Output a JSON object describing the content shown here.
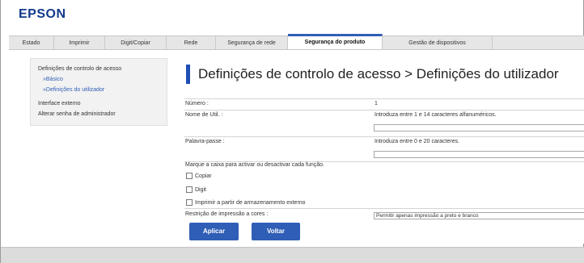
{
  "header": {
    "logo": "EPSON"
  },
  "tabs": [
    {
      "label": "Estado"
    },
    {
      "label": "Imprimir"
    },
    {
      "label": "Digit/Copiar"
    },
    {
      "label": "Rede"
    },
    {
      "label": "Segurança de rede"
    },
    {
      "label": "Segurança do produto"
    },
    {
      "label": "Gestão de dispositivos"
    }
  ],
  "sidebar": {
    "group_label": "Definições de controlo de acesso",
    "sub_items": [
      {
        "label": "»Básico"
      },
      {
        "label": "»Definições do utilizador"
      }
    ],
    "items": [
      {
        "label": "Interface externo"
      },
      {
        "label": "Alterar senha de administrador"
      }
    ]
  },
  "page": {
    "title": "Definições de controlo de acesso > Definições do utilizador"
  },
  "form": {
    "number": {
      "label": "Número :",
      "value": "1"
    },
    "username": {
      "label": "Nome de Util. :",
      "hint": "Introduza entre 1 e 14 caracteres alfanuméricos.",
      "value": ""
    },
    "password": {
      "label": "Palavra-passe :",
      "hint": "Introduza entre 0 e 20 caracteres.",
      "value": ""
    },
    "functions_instruction": "Marque a caixa para activar ou desactivar cada função.",
    "functions": [
      {
        "label": "Copiar",
        "checked": false
      },
      {
        "label": "Digit",
        "checked": false
      },
      {
        "label": "Imprimir a partir de armazenamento externo",
        "checked": false
      }
    ],
    "color_restriction": {
      "label": "Restrição de impressão a cores :",
      "selected": "Permitir apenas impressão a preto e branco"
    }
  },
  "buttons": {
    "apply": "Aplicar",
    "back": "Voltar"
  },
  "colors": {
    "accent": "#2f5eb6",
    "brand": "#123a8c"
  }
}
